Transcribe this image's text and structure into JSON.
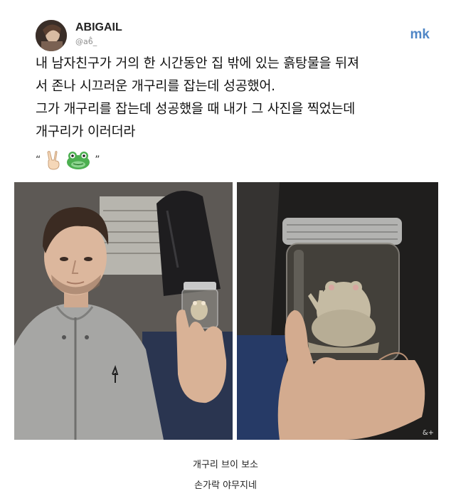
{
  "tweet": {
    "username": "ABIGAIL",
    "handle": "@a6̂_",
    "watermark": "mk",
    "lines": [
      "내 남자친구가 거의 한 시간동안 집 밖에 있는 흙탕물을 뒤져",
      "서 존나 시끄러운 개구리를 잡는데 성공했어.",
      "그가 개구리를 잡는데 성공했을 때 내가 그 사진을 찍었는데",
      "개구리가 이러더라"
    ],
    "quote_open": "“",
    "quote_close": "”",
    "emoji_icons": [
      "peace-sign-hand-icon",
      "frog-face-icon"
    ]
  },
  "photos": {
    "left_description_icon": "man-holding-jar-photo",
    "right_description_icon": "frog-in-jar-photo",
    "corner_mark": "&+"
  },
  "captions": [
    "개구리 브이 보소",
    "손가락 야무지네"
  ],
  "colors": {
    "watermark": "#4f86c6",
    "background": "#ffffff"
  }
}
